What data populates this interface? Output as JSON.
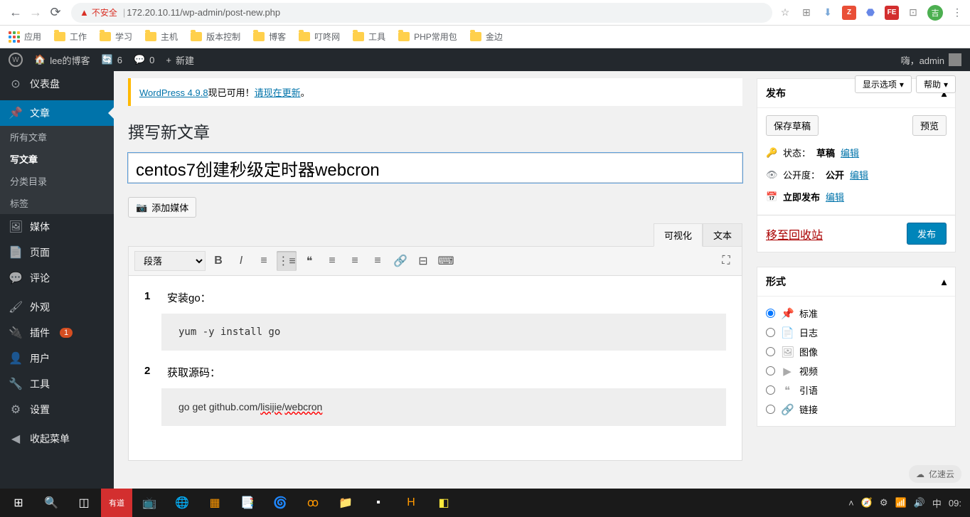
{
  "browser": {
    "warning": "不安全",
    "url_host": "172.20.10.11",
    "url_path": "/wp-admin/post-new.php"
  },
  "bookmarks": {
    "apps": "应用",
    "items": [
      "工作",
      "学习",
      "主机",
      "版本控制",
      "博客",
      "叮咚网",
      "工具",
      "PHP常用包",
      "金边"
    ]
  },
  "adminbar": {
    "site": "lee的博客",
    "updates": "6",
    "comments": "0",
    "new": "新建",
    "greeting": "嗨，admin"
  },
  "sidebar": {
    "dashboard": "仪表盘",
    "posts": "文章",
    "all_posts": "所有文章",
    "new_post": "写文章",
    "categories": "分类目录",
    "tags": "标签",
    "media": "媒体",
    "pages": "页面",
    "comments": "评论",
    "appearance": "外观",
    "plugins": "插件",
    "plugin_updates": "1",
    "users": "用户",
    "tools": "工具",
    "settings": "设置",
    "collapse": "收起菜单"
  },
  "screen_options": "显示选项",
  "help": "帮助",
  "notice": {
    "prefix": "WordPress 4.9.8",
    "text": "现已可用！",
    "link": "请现在更新",
    "suffix": "。"
  },
  "page_title": "撰写新文章",
  "post_title": "centos7创建秒级定时器webcron",
  "add_media": "添加媒体",
  "editor_tabs": {
    "visual": "可视化",
    "text": "文本"
  },
  "format_select": "段落",
  "content": {
    "step1_num": "1",
    "step1_text": "安装go：",
    "code1": "yum  -y  install  go",
    "step2_num": "2",
    "step2_text": "获取源码：",
    "code2_a": "go  get  github.com/",
    "code2_b": "lisijie",
    "code2_c": "/",
    "code2_d": "webcron"
  },
  "publish": {
    "title": "发布",
    "save_draft": "保存草稿",
    "preview": "预览",
    "status_label": "状态：",
    "status_value": "草稿",
    "edit": "编辑",
    "visibility_label": "公开度：",
    "visibility_value": "公开",
    "schedule_label": "立即发布",
    "trash": "移至回收站",
    "submit": "发布"
  },
  "format": {
    "title": "形式",
    "items": [
      "标准",
      "日志",
      "图像",
      "视频",
      "引语",
      "链接"
    ]
  },
  "taskbar": {
    "lang": "中",
    "time": "09:",
    "watermark": "亿速云"
  }
}
